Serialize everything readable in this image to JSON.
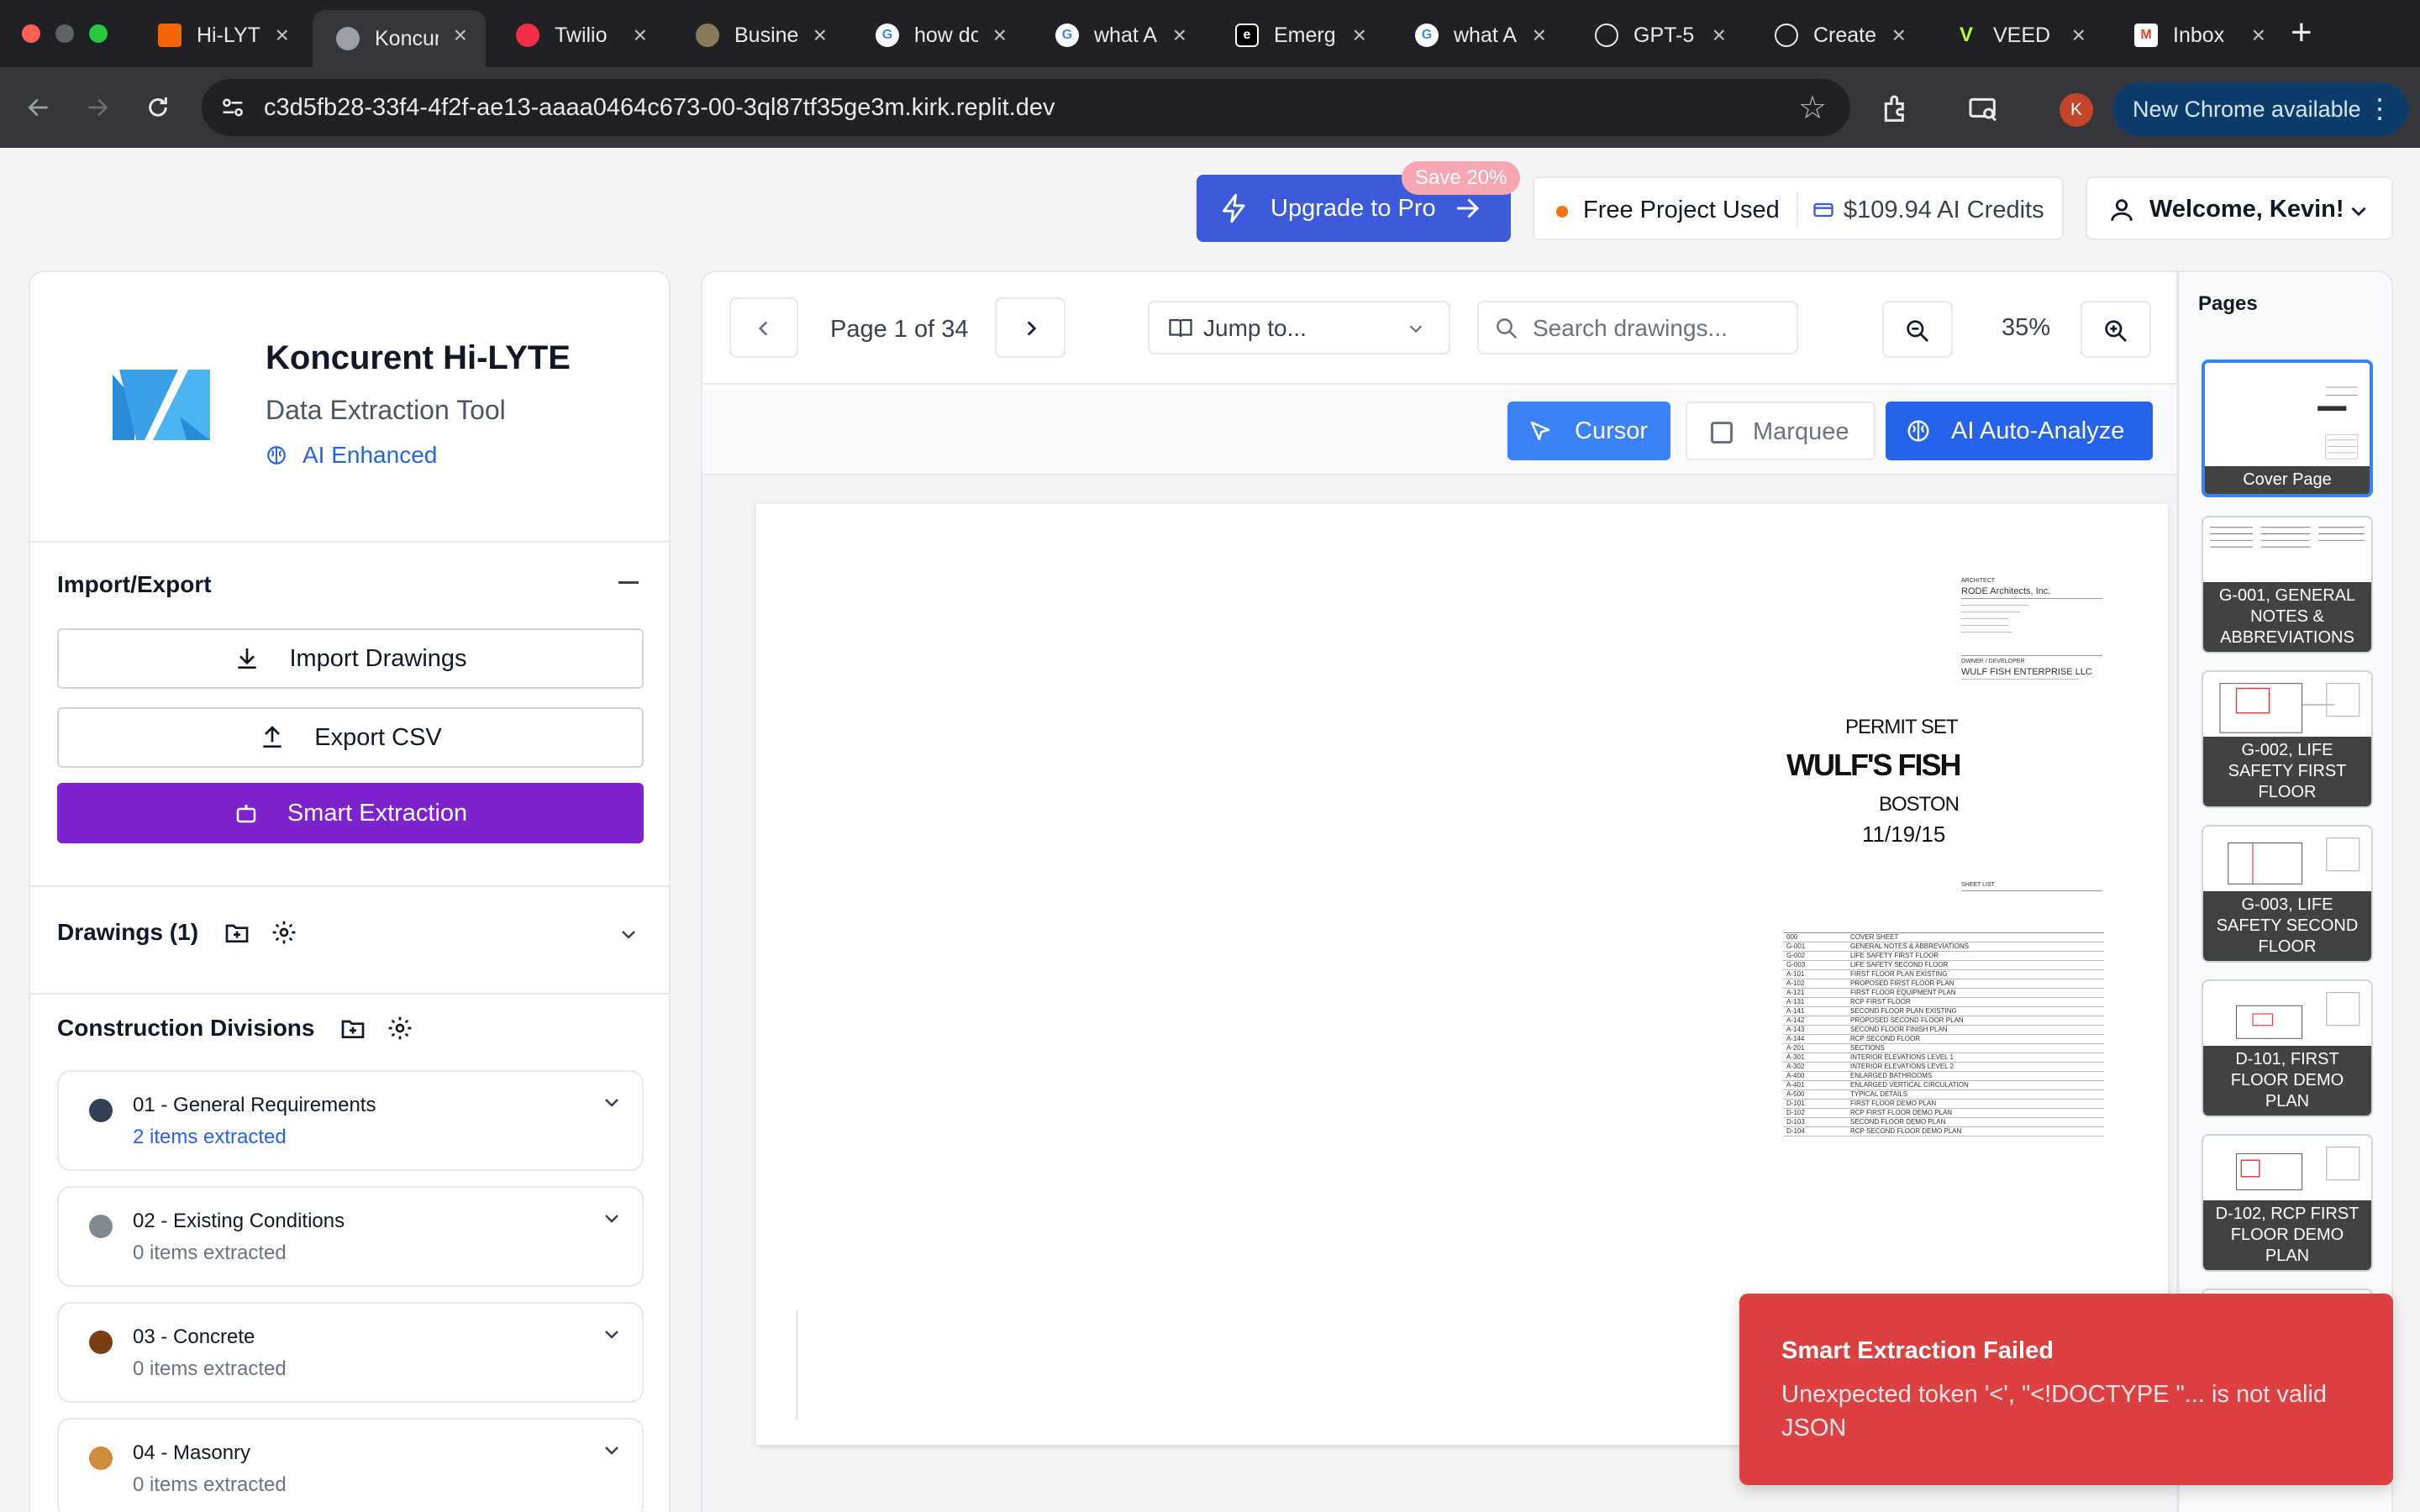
{
  "browser": {
    "tabs": [
      {
        "label": "Hi-LYTE",
        "favicon": "replit-icon",
        "active": false
      },
      {
        "label": "Koncurent",
        "favicon": "globe-icon",
        "active": true
      },
      {
        "label": "Twilio",
        "favicon": "twilio-icon",
        "active": false
      },
      {
        "label": "Business",
        "favicon": "seal-icon",
        "active": false
      },
      {
        "label": "how do",
        "favicon": "google-icon",
        "active": false
      },
      {
        "label": "what A",
        "favicon": "google-icon",
        "active": false
      },
      {
        "label": "Emerg",
        "favicon": "emergent-icon",
        "active": false
      },
      {
        "label": "what A",
        "favicon": "google-icon",
        "active": false
      },
      {
        "label": "GPT-5",
        "favicon": "openai-icon",
        "active": false
      },
      {
        "label": "Create",
        "favicon": "openai-icon",
        "active": false
      },
      {
        "label": "VEED",
        "favicon": "veed-icon",
        "active": false
      },
      {
        "label": "Inbox",
        "favicon": "gmail-icon",
        "active": false
      }
    ],
    "url": "c3d5fb28-33f4-4f2f-ae13-aaaa0464c673-00-3ql87tf35ge3m.kirk.replit.dev",
    "profile_initial": "K",
    "new_chrome_label": "New Chrome available"
  },
  "header": {
    "upgrade_label": "Upgrade to Pro",
    "save_badge": "Save 20%",
    "free_project": "Free Project Used",
    "credits": "$109.94 AI Credits",
    "welcome": "Welcome, Kevin!"
  },
  "sidebar": {
    "app_title": "Koncurent Hi-LYTE",
    "app_subtitle": "Data Extraction Tool",
    "ai_badge": "AI Enhanced",
    "import_export_title": "Import/Export",
    "import_label": "Import Drawings",
    "export_label": "Export CSV",
    "smart_label": "Smart Extraction",
    "drawings_title": "Drawings (1)",
    "divisions_title": "Construction Divisions",
    "divisions": [
      {
        "name": "01 - General Requirements",
        "count": "2 items extracted",
        "color": "#334155"
      },
      {
        "name": "02 - Existing Conditions",
        "count": "0 items extracted",
        "color": "#808a8f"
      },
      {
        "name": "03 - Concrete",
        "count": "0 items extracted",
        "color": "#7c3d12"
      },
      {
        "name": "04 - Masonry",
        "count": "0 items extracted",
        "color": "#cf8c3f"
      }
    ]
  },
  "viewer": {
    "page_label": "Page 1 of 34",
    "jump_label": "Jump to...",
    "search_placeholder": "Search drawings...",
    "zoom": "35%",
    "cursor_label": "Cursor",
    "marquee_label": "Marquee",
    "ai_label": "AI Auto-Analyze",
    "sheet": {
      "architect": "RODE Architects, Inc.",
      "owner": "WULF FISH ENTERPRISE LLC",
      "permit": "PERMIT SET",
      "project": "WULF'S FISH",
      "city": "BOSTON",
      "date": "11/19/15",
      "index": [
        {
          "num": "000",
          "desc": "COVER SHEET"
        },
        {
          "num": "G-001",
          "desc": "GENERAL NOTES & ABBREVIATIONS"
        },
        {
          "num": "G-002",
          "desc": "LIFE SAFETY FIRST FLOOR"
        },
        {
          "num": "G-003",
          "desc": "LIFE SAFETY SECOND FLOOR"
        },
        {
          "num": "A-101",
          "desc": "FIRST FLOOR PLAN EXISTING"
        },
        {
          "num": "A-102",
          "desc": "PROPOSED FIRST FLOOR PLAN"
        },
        {
          "num": "A-121",
          "desc": "FIRST FLOOR EQUIPMENT PLAN"
        },
        {
          "num": "A-131",
          "desc": "RCP FIRST FLOOR"
        },
        {
          "num": "A-141",
          "desc": "SECOND FLOOR PLAN EXISTING"
        },
        {
          "num": "A-142",
          "desc": "PROPOSED SECOND FLOOR PLAN"
        },
        {
          "num": "A-143",
          "desc": "SECOND FLOOR FINISH PLAN"
        },
        {
          "num": "A-144",
          "desc": "RCP SECOND FLOOR"
        },
        {
          "num": "A-201",
          "desc": "SECTIONS"
        },
        {
          "num": "A-301",
          "desc": "INTERIOR ELEVATIONS LEVEL 1"
        },
        {
          "num": "A-302",
          "desc": "INTERIOR ELEVATIONS LEVEL 2"
        },
        {
          "num": "A-400",
          "desc": "ENLARGED BATHROOMS"
        },
        {
          "num": "A-401",
          "desc": "ENLARGED VERTICAL CIRCULATION"
        },
        {
          "num": "A-500",
          "desc": "TYPICAL DETAILS"
        },
        {
          "num": "D-101",
          "desc": "FIRST FLOOR DEMO PLAN"
        },
        {
          "num": "D-102",
          "desc": "RCP FIRST FLOOR DEMO PLAN"
        },
        {
          "num": "D-103",
          "desc": "SECOND FLOOR DEMO PLAN"
        },
        {
          "num": "D-104",
          "desc": "RCP SECOND FLOOR DEMO PLAN"
        }
      ]
    }
  },
  "pages": {
    "title": "Pages",
    "items": [
      {
        "label": "Cover Page"
      },
      {
        "label": "G-001, GENERAL NOTES & ABBREVIATIONS"
      },
      {
        "label": "G-002, LIFE SAFETY FIRST FLOOR"
      },
      {
        "label": "G-003, LIFE SAFETY SECOND FLOOR"
      },
      {
        "label": "D-101, FIRST FLOOR DEMO PLAN"
      },
      {
        "label": "D-102, RCP FIRST FLOOR DEMO PLAN"
      }
    ]
  },
  "toast": {
    "title": "Smart Extraction Failed",
    "message": "Unexpected token '<', \"<!DOCTYPE \"... is not valid JSON"
  },
  "colors": {
    "accent_blue": "#2563eb",
    "purple": "#7e22ce",
    "error_red": "#dc4040"
  }
}
